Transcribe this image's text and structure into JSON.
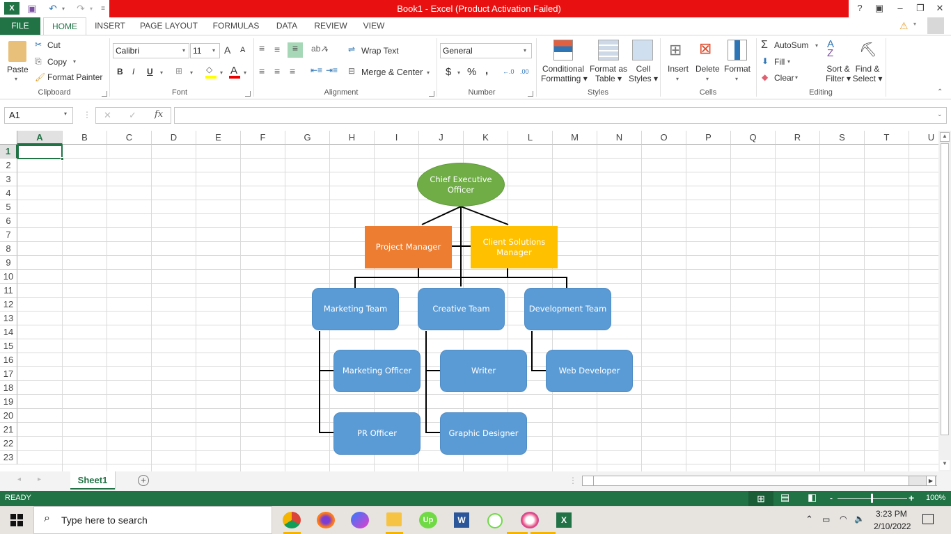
{
  "window": {
    "title": "Book1 -  Excel (Product Activation Failed)",
    "help": "?",
    "controls": {
      "restore_ribbon": "▣",
      "minimize": "–",
      "maximize": "❐",
      "close": "✕"
    }
  },
  "qat": {
    "undo": "↶",
    "redo": "↷",
    "customize": "⩡"
  },
  "tabs": [
    "FILE",
    "HOME",
    "INSERT",
    "PAGE LAYOUT",
    "FORMULAS",
    "DATA",
    "REVIEW",
    "VIEW"
  ],
  "ribbon": {
    "clipboard": {
      "paste": "Paste",
      "cut": "Cut",
      "copy": "Copy",
      "format_painter": "Format Painter",
      "label": "Clipboard"
    },
    "font": {
      "name": "Calibri",
      "size": "11",
      "grow": "A",
      "shrink": "A",
      "bold": "B",
      "italic": "I",
      "underline": "U",
      "label": "Font",
      "font_color": "A"
    },
    "alignment": {
      "wrap_text": "Wrap Text",
      "merge_center": "Merge & Center",
      "label": "Alignment"
    },
    "number": {
      "format": "General",
      "currency": "$",
      "percent": "%",
      "comma": ",",
      "inc_decimal": "←.0",
      "dec_decimal": ".00",
      "label": "Number"
    },
    "styles": {
      "conditional": [
        "Conditional",
        "Formatting"
      ],
      "format_table": [
        "Format as",
        "Table"
      ],
      "cell_styles": [
        "Cell",
        "Styles"
      ],
      "label": "Styles"
    },
    "cells": {
      "insert": "Insert",
      "delete": "Delete",
      "format": "Format",
      "label": "Cells"
    },
    "editing": {
      "autosum": "AutoSum",
      "fill": "Fill",
      "clear": "Clear",
      "sort": [
        "Sort &",
        "Filter"
      ],
      "find": [
        "Find &",
        "Select"
      ],
      "label": "Editing"
    }
  },
  "formula_bar": {
    "name_box": "A1",
    "cancel": "✕",
    "enter": "✓",
    "fx": "fx",
    "value": ""
  },
  "columns": [
    "A",
    "B",
    "C",
    "D",
    "E",
    "F",
    "G",
    "H",
    "I",
    "J",
    "K",
    "L",
    "M",
    "N",
    "O",
    "P",
    "Q",
    "R",
    "S",
    "T",
    "U"
  ],
  "rows": [
    "1",
    "2",
    "3",
    "4",
    "5",
    "6",
    "7",
    "8",
    "9",
    "10",
    "11",
    "12",
    "13",
    "14",
    "15",
    "16",
    "17",
    "18",
    "19",
    "20",
    "21",
    "22",
    "23"
  ],
  "org_chart": {
    "ceo": "Chief Executive Officer",
    "project_manager": "Project Manager",
    "client_solutions": "Client Solutions Manager",
    "marketing_team": "Marketing Team",
    "creative_team": "Creative Team",
    "development_team": "Development Team",
    "marketing_officer": "Marketing Officer",
    "pr_officer": "PR Officer",
    "writer": "Writer",
    "graphic_designer": "Graphic Designer",
    "web_developer": "Web Developer",
    "colors": {
      "ceo": "#70ad47",
      "project_manager": "#ed7d31",
      "client_solutions": "#ffc000",
      "teams": "#5b9bd5"
    }
  },
  "sheets": {
    "tabs": [
      "Sheet1"
    ],
    "add": "+"
  },
  "status": {
    "mode": "READY",
    "zoom": "100%",
    "zoom_minus": "-",
    "zoom_plus": "+"
  },
  "taskbar": {
    "search_placeholder": "Type here to search",
    "time": "3:23 PM",
    "date": "2/10/2022"
  }
}
